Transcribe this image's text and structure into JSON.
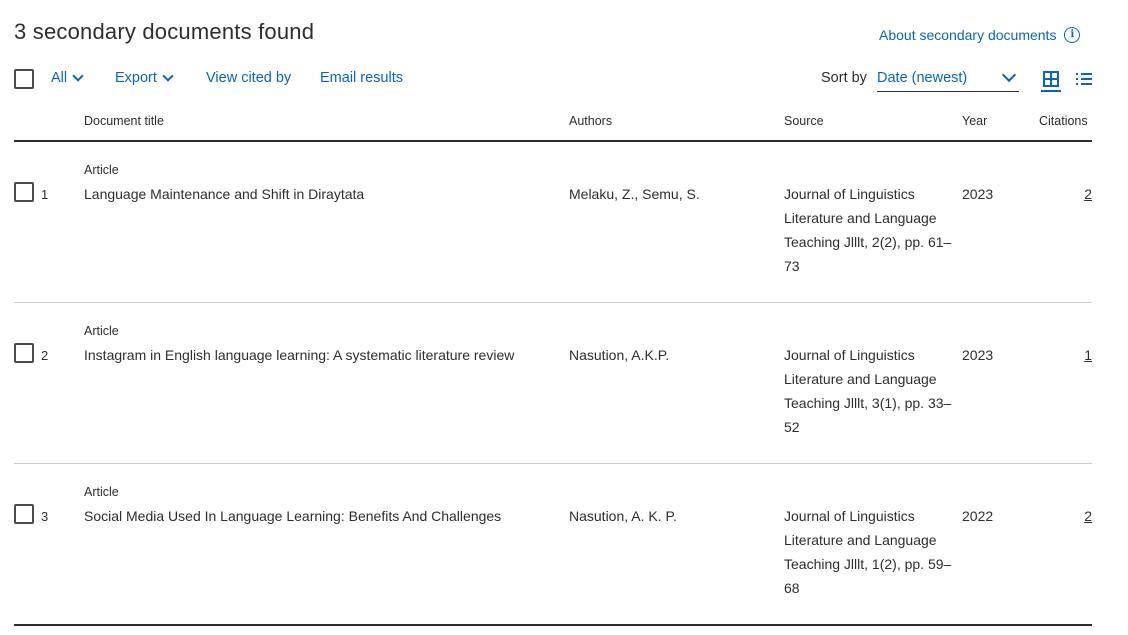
{
  "header": {
    "title": "3 secondary documents found",
    "about_label": "About secondary documents",
    "info_glyph": "i"
  },
  "toolbar": {
    "all_label": "All",
    "export_label": "Export",
    "view_cited_label": "View cited by",
    "email_label": "Email results",
    "sort_label": "Sort by",
    "sort_value": "Date (newest)"
  },
  "columns": {
    "title": "Document title",
    "authors": "Authors",
    "source": "Source",
    "year": "Year",
    "citations": "Citations"
  },
  "rows": [
    {
      "num": "1",
      "type": "Article",
      "title": "Language Maintenance and Shift in Diraytata",
      "authors": "Melaku, Z., Semu, S.",
      "source": "Journal of Linguistics Literature and Language Teaching Jlllt, 2(2), pp. 61–73",
      "year": "2023",
      "citations": "2"
    },
    {
      "num": "2",
      "type": "Article",
      "title": "Instagram in English language learning: A systematic literature review",
      "authors": "Nasution, A.K.P.",
      "source": "Journal of Linguistics Literature and Language Teaching Jlllt, 3(1), pp. 33–52",
      "year": "2023",
      "citations": "1"
    },
    {
      "num": "3",
      "type": "Article",
      "title": "Social Media Used In Language Learning: Benefits And Challenges",
      "authors": "Nasution, A. K. P.",
      "source": "Journal of Linguistics Literature and Language Teaching Jlllt, 1(2), pp. 59–68",
      "year": "2022",
      "citations": "2"
    }
  ],
  "colors": {
    "link": "#0b64c0",
    "text": "#2e2e2e",
    "divider": "#cfcfcf"
  }
}
